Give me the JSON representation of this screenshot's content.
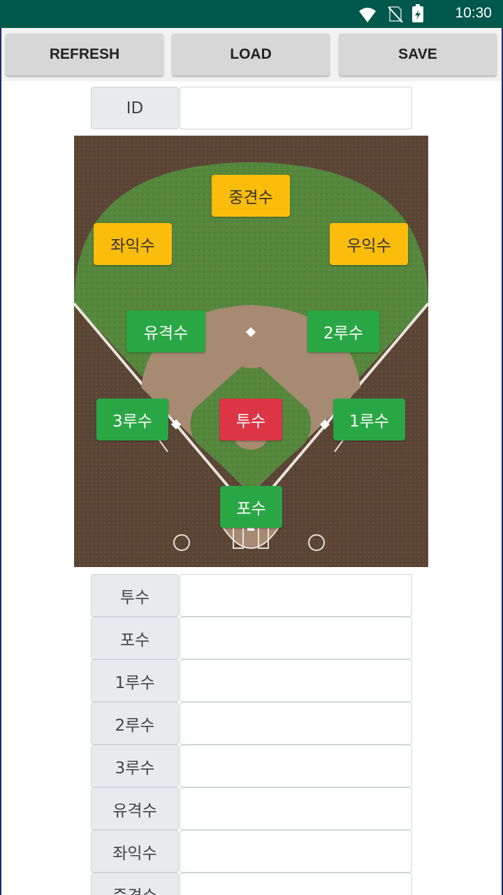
{
  "status_bar": {
    "time": "10:30",
    "icons": [
      "wifi-icon",
      "no-sim-icon",
      "battery-icon"
    ],
    "color": "#00574b"
  },
  "toolbar": {
    "refresh_label": "REFRESH",
    "load_label": "LOAD",
    "save_label": "SAVE"
  },
  "id_row": {
    "label": "ID",
    "value": ""
  },
  "field_positions": {
    "center_field": "중견수",
    "left_field": "좌익수",
    "right_field": "우익수",
    "shortstop": "유격수",
    "second_base": "2루수",
    "third_base": "3루수",
    "pitcher": "투수",
    "first_base": "1루수",
    "catcher": "포수"
  },
  "roster": [
    {
      "label": "투수",
      "value": ""
    },
    {
      "label": "포수",
      "value": ""
    },
    {
      "label": "1루수",
      "value": ""
    },
    {
      "label": "2루수",
      "value": ""
    },
    {
      "label": "3루수",
      "value": ""
    },
    {
      "label": "유격수",
      "value": ""
    },
    {
      "label": "좌익수",
      "value": ""
    },
    {
      "label": "중견수",
      "value": ""
    }
  ],
  "colors": {
    "outfield": "#fbbd0b",
    "infield": "#2aa745",
    "pitcher": "#dc3545"
  }
}
